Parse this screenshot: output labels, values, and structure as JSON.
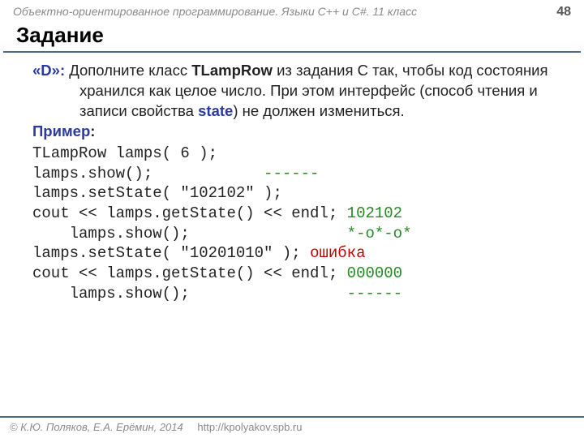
{
  "header": {
    "subject": "Объектно-ориентированное программирование. Языки C++ и C#. 11 класс",
    "page": "48"
  },
  "title": "Задание",
  "task": {
    "label": "«D»:",
    "text_before_class": " Дополните класс ",
    "class_name": "TLampRow",
    "text_after_class": " из задания C так, чтобы код состояния хранился как целое число. При этом интерфейс (способ чтения и записи свойства ",
    "state_word": "state",
    "text_end": ") не должен измениться."
  },
  "example_label": "Пример",
  "code": {
    "l1": "TLampRow lamps( 6 );",
    "l2_code": "lamps.show();            ",
    "l2_out": "------",
    "l3": "lamps.setState( \"102102\" );",
    "l4_code": "cout << lamps.getState() << endl; ",
    "l4_out": "102102",
    "l5_code": "    lamps.show();                 ",
    "l5_out": "*-o*-o*",
    "l6_code": "lamps.setState( \"10201010\" ); ",
    "l6_err": "ошибка",
    "l7_code": "cout << lamps.getState() << endl; ",
    "l7_out": "000000",
    "l8_code": "    lamps.show();                 ",
    "l8_out": "------"
  },
  "footer": {
    "copyright": "© К.Ю. Поляков, Е.А. Ерёмин, 2014",
    "url": "http://kpolyakov.spb.ru"
  }
}
